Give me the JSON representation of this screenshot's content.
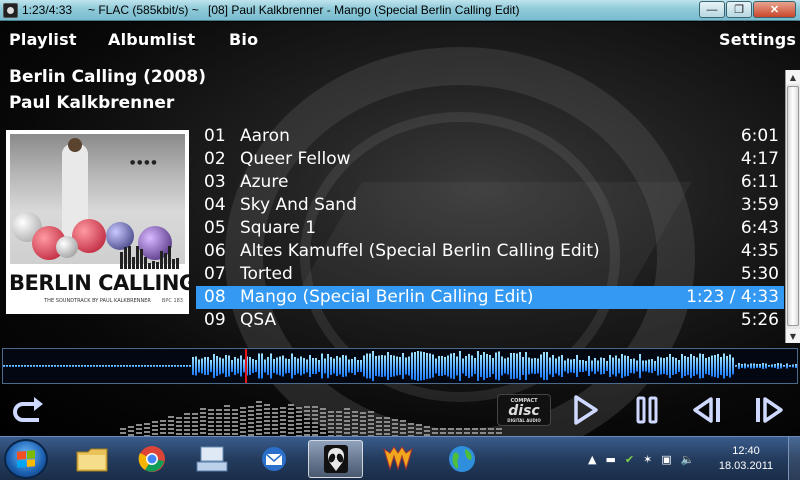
{
  "window": {
    "time": "1:23/4:33",
    "format": "~ FLAC (585kbit/s) ~",
    "track": "[08] Paul Kalkbrenner - Mango (Special Berlin Calling Edit)",
    "min_icon": "minimize-icon",
    "max_icon": "maximize-icon",
    "close_icon": "close-icon"
  },
  "nav": {
    "playlist": "Playlist",
    "albumlist": "Albumlist",
    "bio": "Bio",
    "settings": "Settings"
  },
  "album": {
    "title": "Berlin Calling (2008)",
    "artist": "Paul Kalkbrenner"
  },
  "cover": {
    "title": "BERLIN CALLING",
    "subtitle": "THE SOUNDTRACK BY PAUL KALKBRENNER",
    "catalog": "BPC 183"
  },
  "tracks": [
    {
      "num": "01",
      "name": "Aaron",
      "dur": "6:01"
    },
    {
      "num": "02",
      "name": "Queer Fellow",
      "dur": "4:17"
    },
    {
      "num": "03",
      "name": "Azure",
      "dur": "6:11"
    },
    {
      "num": "04",
      "name": "Sky And Sand",
      "dur": "3:59"
    },
    {
      "num": "05",
      "name": "Square 1",
      "dur": "6:43"
    },
    {
      "num": "06",
      "name": "Altes Kamuffel (Special Berlin Calling Edit)",
      "dur": "4:35"
    },
    {
      "num": "07",
      "name": "Torted",
      "dur": "5:30"
    },
    {
      "num": "08",
      "name": "Mango (Special Berlin Calling Edit)",
      "dur": "1:23 / 4:33",
      "active": true
    },
    {
      "num": "09",
      "name": "QSA",
      "dur": "5:26"
    }
  ],
  "playback": {
    "progress_fraction": 0.304
  },
  "controls": {
    "repeat_icon": "repeat-icon",
    "cd_line1": "COMPACT",
    "cd_line2": "disc",
    "cd_line3": "DIGITAL AUDIO",
    "play_icon": "play-icon",
    "pause_icon": "pause-icon",
    "prev_icon": "previous-track-icon",
    "next_icon": "next-track-icon"
  },
  "taskbar": {
    "apps": [
      "windows-explorer-icon",
      "chrome-icon",
      "keyboard-app-icon",
      "email-client-icon",
      "alien-player-icon",
      "winamp-icon",
      "globe-icon"
    ],
    "clock_time": "12:40",
    "clock_date": "18.03.2011"
  },
  "colors": {
    "accent": "#3399f3",
    "wave": "#1b7cff",
    "cursor": "#e0161b"
  }
}
